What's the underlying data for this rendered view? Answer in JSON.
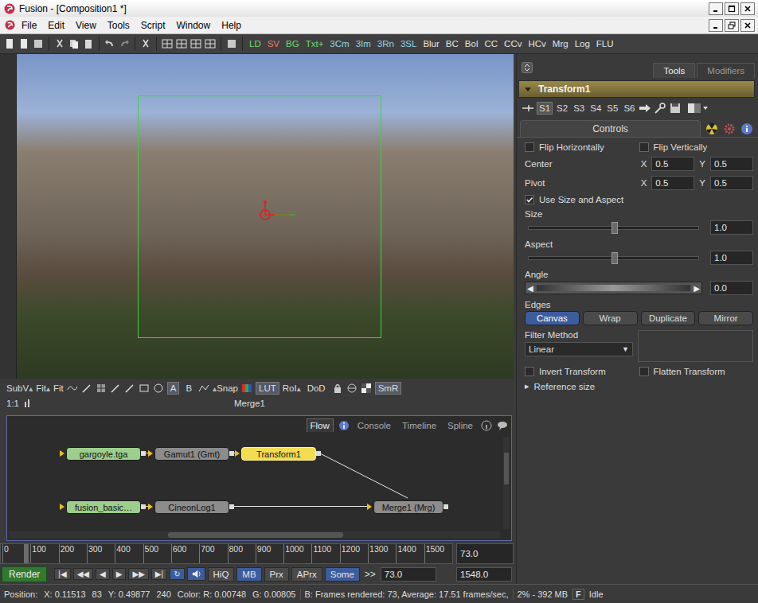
{
  "window": {
    "title": "Fusion - [Composition1 *]"
  },
  "menu": [
    "File",
    "Edit",
    "View",
    "Tools",
    "Script",
    "Window",
    "Help"
  ],
  "toolbar_tools": [
    {
      "label": "LD",
      "color": "#6fd86f"
    },
    {
      "label": "SV",
      "color": "#f07a6a"
    },
    {
      "label": "BG",
      "color": "#6fd86f"
    },
    {
      "label": "Txt+",
      "color": "#6fd86f"
    },
    {
      "label": "3Cm",
      "color": "#8fd6e6"
    },
    {
      "label": "3Im",
      "color": "#8fd6e6"
    },
    {
      "label": "3Rn",
      "color": "#8fd6e6"
    },
    {
      "label": "3SL",
      "color": "#8fd6e6"
    },
    {
      "label": "Blur",
      "color": "#e4e4e4"
    },
    {
      "label": "BC",
      "color": "#e4e4e4"
    },
    {
      "label": "Bol",
      "color": "#e4e4e4"
    },
    {
      "label": "CC",
      "color": "#e4e4e4"
    },
    {
      "label": "CCv",
      "color": "#e4e4e4"
    },
    {
      "label": "HCv",
      "color": "#e4e4e4"
    },
    {
      "label": "Mrg",
      "color": "#e4e4e4"
    },
    {
      "label": "Log",
      "color": "#e4e4e4"
    },
    {
      "label": "FLU",
      "color": "#e4e4e4"
    }
  ],
  "viewer": {
    "menus": [
      {
        "label": "SubV",
        "arrow": "▴"
      },
      {
        "label": "Fit",
        "arrow": "▴"
      },
      {
        "label": "Fit"
      }
    ],
    "channels": [
      {
        "label": "A",
        "selected": true
      },
      {
        "label": "B",
        "selected": false
      }
    ],
    "snap": {
      "label": "Snap",
      "arrow": "▴"
    },
    "lut": {
      "label": "LUT",
      "selected": true
    },
    "roi": {
      "label": "RoI",
      "arrow": "▴"
    },
    "dod": {
      "label": "DoD",
      "selected": false
    },
    "smr": {
      "label": "SmR",
      "selected": true
    },
    "zoom": "1:1",
    "view_name": "Merge1"
  },
  "flow": {
    "tabs": [
      {
        "label": "Flow",
        "selected": true
      },
      {
        "label": "Console",
        "selected": false
      },
      {
        "label": "Timeline",
        "selected": false
      },
      {
        "label": "Spline",
        "selected": false
      }
    ],
    "nodes": [
      {
        "label": "gargoyle.tga",
        "color": "#9ccf8c",
        "selected": false
      },
      {
        "label": "Gamut1 (Gmt)",
        "color": "#8c8c8c",
        "selected": false
      },
      {
        "label": "Transform1",
        "color": "#f2dc52",
        "selected": true
      },
      {
        "label": "fusion_basic…",
        "color": "#9ccf8c",
        "selected": false
      },
      {
        "label": "CineonLog1",
        "color": "#8c8c8c",
        "selected": false
      },
      {
        "label": "Merge1  (Mrg)",
        "color": "#8c8c8c",
        "selected": false
      }
    ]
  },
  "ruler": {
    "ticks": [
      "0",
      "100",
      "200",
      "300",
      "400",
      "500",
      "600",
      "700",
      "800",
      "900",
      "1000",
      "1100",
      "1200",
      "1300",
      "1400",
      "1500"
    ],
    "playhead": 0.047,
    "current": "73.0"
  },
  "transport": {
    "render": "Render",
    "buttons": [
      "|◀",
      "◀◀",
      "◀",
      "▶",
      "▶▶",
      "▶|"
    ],
    "loop": {
      "label": "↻",
      "selected": true
    },
    "options": [
      {
        "label": "HiQ",
        "selected": false
      },
      {
        "label": "MB",
        "selected": true
      },
      {
        "label": "Prx",
        "selected": false
      },
      {
        "label": "APrx",
        "selected": false
      },
      {
        "label": "Some",
        "selected": true
      }
    ],
    "more": ">>",
    "current": "73.0",
    "end": "1548.0"
  },
  "panel": {
    "tabs": [
      {
        "label": "Tools",
        "selected": true
      },
      {
        "label": "Modifiers",
        "selected": false
      }
    ],
    "tool_name": "Transform1",
    "expanded": true,
    "slots": [
      {
        "label": "S1",
        "selected": true
      },
      {
        "label": "S2",
        "selected": false
      },
      {
        "label": "S3",
        "selected": false
      },
      {
        "label": "S4",
        "selected": false
      },
      {
        "label": "S5",
        "selected": false
      },
      {
        "label": "S6",
        "selected": false
      }
    ],
    "control_tab": {
      "label": "Controls",
      "selected": true
    },
    "controls": [
      {
        "kind": "checks",
        "items": [
          {
            "label": "Flip Horizontally",
            "checked": false
          },
          {
            "label": "Flip Vertically",
            "checked": false
          }
        ]
      },
      {
        "kind": "xy",
        "label": "Center",
        "x_label": "X",
        "x": "0.5",
        "y_label": "Y",
        "y": "0.5"
      },
      {
        "kind": "xy",
        "label": "Pivot",
        "x_label": "X",
        "x": "0.5",
        "y_label": "Y",
        "y": "0.5"
      },
      {
        "kind": "checks",
        "items": [
          {
            "label": "Use Size and Aspect",
            "checked": true
          }
        ]
      },
      {
        "kind": "slider",
        "label": "Size",
        "level": 0.5,
        "value": "1.0"
      },
      {
        "kind": "slider",
        "label": "Aspect",
        "level": 0.5,
        "value": "1.0"
      },
      {
        "kind": "angle",
        "label": "Angle",
        "left": "◀",
        "right": "▶",
        "value": "0.0"
      },
      {
        "kind": "buttons",
        "label": "Edges",
        "options": [
          {
            "label": "Canvas",
            "selected": true
          },
          {
            "label": "Wrap",
            "selected": false
          },
          {
            "label": "Duplicate",
            "selected": false
          },
          {
            "label": "Mirror",
            "selected": false
          }
        ]
      },
      {
        "kind": "dropdown",
        "label": "Filter Method",
        "value": "Linear",
        "arrow": "▼"
      },
      {
        "kind": "checks",
        "items": [
          {
            "label": "Invert Transform",
            "checked": false
          },
          {
            "label": "Flatten Transform",
            "checked": false
          }
        ]
      },
      {
        "kind": "expander",
        "label": "Reference size",
        "arrow": "▸",
        "expanded": false
      }
    ]
  },
  "status_bar": [
    "Position:",
    "X: 0.11513",
    "83",
    "Y: 0.49877",
    "240",
    "Color: R: 0.00748",
    "G: 0.00805",
    "B: Frames rendered: 73, Average: 17.51 frames/sec,",
    "2% - 392 MB",
    "F",
    "Idle"
  ]
}
